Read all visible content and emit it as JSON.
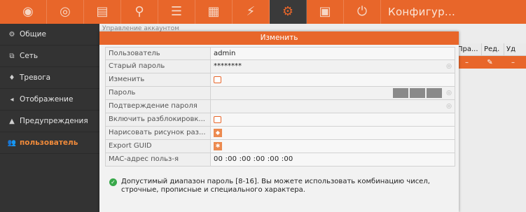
{
  "toolbar": {
    "items": [
      {
        "icon": "playback-icon",
        "glyph": "◉"
      },
      {
        "icon": "camera-icon",
        "glyph": "◎"
      },
      {
        "icon": "file-management-icon",
        "glyph": "▤"
      },
      {
        "icon": "ptz-icon",
        "glyph": "⚲"
      },
      {
        "icon": "storage-icon",
        "glyph": "☰"
      },
      {
        "icon": "stats-icon",
        "glyph": "▦"
      },
      {
        "icon": "event-icon",
        "glyph": "⚡"
      },
      {
        "icon": "config-icon",
        "glyph": "⚙"
      },
      {
        "icon": "maintenance-icon",
        "glyph": "▣"
      },
      {
        "icon": "power-icon",
        "glyph": "⏻"
      }
    ],
    "title": "Конфигур..."
  },
  "sidebar": {
    "items": [
      {
        "label": "Общие",
        "icon": "gear-icon",
        "glyph": "⚙"
      },
      {
        "label": "Сеть",
        "icon": "network-icon",
        "glyph": "⧉"
      },
      {
        "label": "Тревога",
        "icon": "alarm-icon",
        "glyph": "♦"
      },
      {
        "label": "Отображение",
        "icon": "display-icon",
        "glyph": "◂"
      },
      {
        "label": "Предупреждения",
        "icon": "warning-icon",
        "glyph": "▲"
      },
      {
        "label": "пользователь",
        "icon": "user-icon",
        "glyph": "👥",
        "active": true
      }
    ]
  },
  "background": {
    "title": "Управление аккаунтом",
    "table": {
      "headers": [
        "Пра...",
        "Ред.",
        "Уд"
      ],
      "row": [
        "–",
        "✎",
        "–"
      ]
    }
  },
  "dialog": {
    "title": "Изменить",
    "fields": {
      "user_label": "Пользователь",
      "user_value": "admin",
      "old_pwd_label": "Старый пароль",
      "old_pwd_value": "********",
      "change_label": "Изменить",
      "pwd_label": "Пароль",
      "confirm_label": "Подтверждение пароля",
      "unlock_label": "Включить разблокировк...",
      "draw_label": "Нарисовать рисунок раз...",
      "guid_label": "Export GUID",
      "mac_label": "MAC-адрес польз-я",
      "mac_value": "00 :00 :00 :00 :00 :00"
    },
    "hint": "Допустимый диапазон пароль [8-16]. Вы можете использовать комбинацию чисел, строчные, прописные и специального характера."
  },
  "colors": {
    "accent": "#e8662a",
    "ok": "#38a84a"
  }
}
